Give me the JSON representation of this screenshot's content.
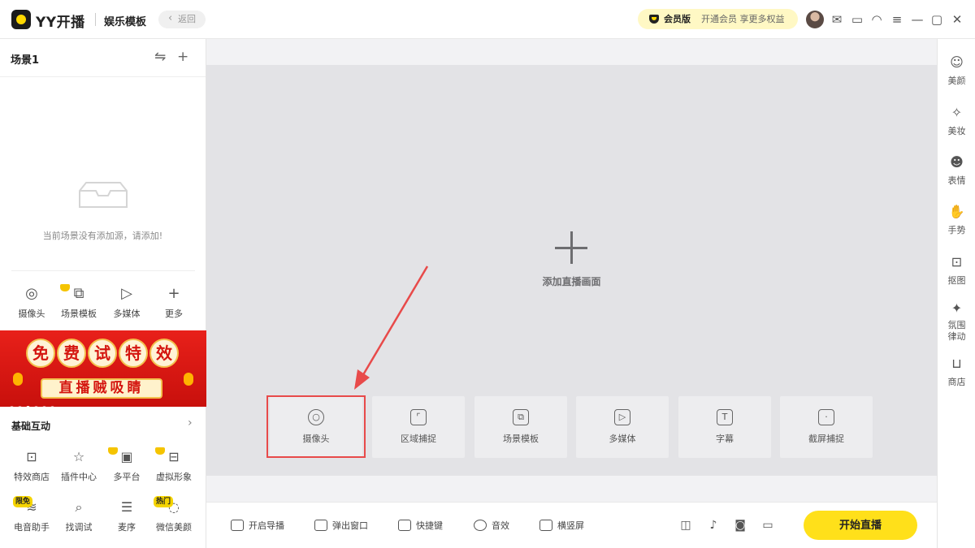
{
  "header": {
    "brand": "YY开播",
    "template": "娱乐模板",
    "back": "返回",
    "vip_label": "会员版",
    "vip_promo": "开通会员 享更多权益",
    "icons": [
      "mail-icon",
      "ticket-icon",
      "headset-icon",
      "menu-icon",
      "minimize-icon",
      "maximize-icon",
      "close-icon"
    ]
  },
  "scene": {
    "title": "场景1",
    "empty_text": "当前场景没有添加源，请添加!",
    "sources": [
      "摄像头",
      "场景模板",
      "多媒体",
      "更多"
    ]
  },
  "banner": {
    "chars": [
      "免",
      "费",
      "试",
      "特",
      "效"
    ],
    "subtitle": "直播贼吸睛"
  },
  "interaction": {
    "title": "基础互动",
    "items": [
      "特效商店",
      "插件中心",
      "多平台",
      "虚拟形象",
      "电音助手",
      "找调试",
      "麦序",
      "微信美颜"
    ],
    "tag_limited": "限免",
    "tag_hot": "热门"
  },
  "main": {
    "add_text": "添加直播画面",
    "cards": [
      "摄像头",
      "区域捕捉",
      "场景模板",
      "多媒体",
      "字幕",
      "截屏捕捉"
    ],
    "highlight_color": "#e84a4a"
  },
  "bottom": {
    "tools": [
      "开启导播",
      "弹出窗口",
      "快捷键",
      "音效",
      "横竖屏"
    ],
    "start": "开始直播"
  },
  "right_panel": {
    "items": [
      "美颜",
      "美妆",
      "表情",
      "手势",
      "抠图",
      "氛围律动",
      "商店"
    ]
  },
  "colors": {
    "accent": "#ffe01a",
    "banner_red": "#d4150f"
  }
}
